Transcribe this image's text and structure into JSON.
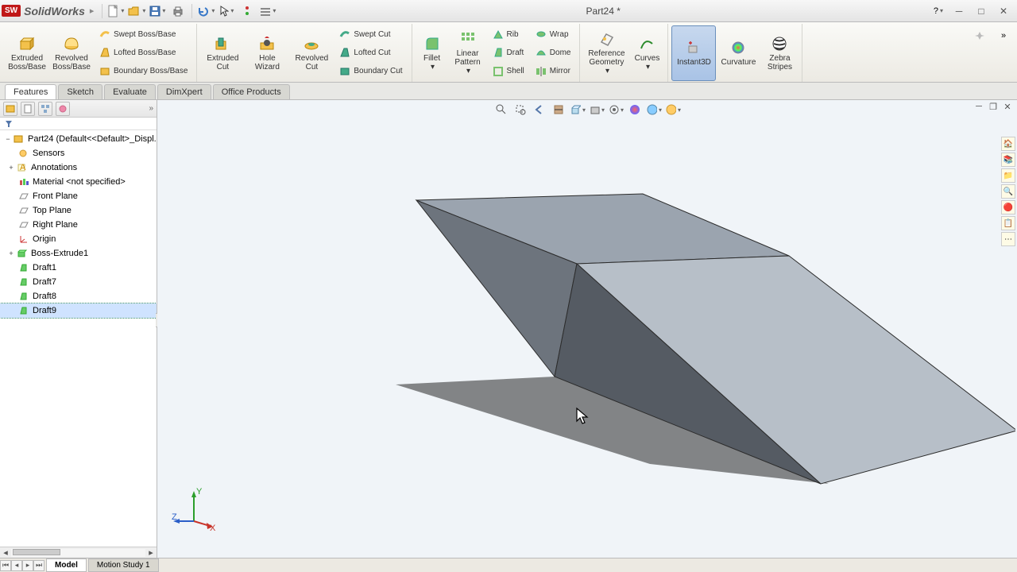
{
  "app": {
    "logo": "SW",
    "name": "SolidWorks",
    "title": "Part24 *"
  },
  "quickaccess": [
    "new",
    "open",
    "save",
    "print",
    "undo",
    "select",
    "rebuild",
    "options"
  ],
  "ribbon": {
    "extruded_boss": "Extruded Boss/Base",
    "revolved_boss": "Revolved Boss/Base",
    "swept_boss": "Swept Boss/Base",
    "lofted_boss": "Lofted Boss/Base",
    "boundary_boss": "Boundary Boss/Base",
    "extruded_cut": "Extruded Cut",
    "hole_wizard": "Hole Wizard",
    "revolved_cut": "Revolved Cut",
    "swept_cut": "Swept Cut",
    "lofted_cut": "Lofted Cut",
    "boundary_cut": "Boundary Cut",
    "fillet": "Fillet",
    "linear_pattern": "Linear Pattern",
    "rib": "Rib",
    "draft": "Draft",
    "shell": "Shell",
    "wrap": "Wrap",
    "dome": "Dome",
    "mirror": "Mirror",
    "ref_geometry": "Reference Geometry",
    "curves": "Curves",
    "instant3d": "Instant3D",
    "curvature": "Curvature",
    "zebra": "Zebra Stripes"
  },
  "tabs": [
    "Features",
    "Sketch",
    "Evaluate",
    "DimXpert",
    "Office Products"
  ],
  "tree": {
    "root": "Part24  (Default<<Default>_Displ.",
    "items": [
      {
        "label": "Sensors",
        "icon": "sensor"
      },
      {
        "label": "Annotations",
        "icon": "annot",
        "expand": "+"
      },
      {
        "label": "Material <not specified>",
        "icon": "material"
      },
      {
        "label": "Front Plane",
        "icon": "plane"
      },
      {
        "label": "Top Plane",
        "icon": "plane"
      },
      {
        "label": "Right Plane",
        "icon": "plane"
      },
      {
        "label": "Origin",
        "icon": "origin"
      },
      {
        "label": "Boss-Extrude1",
        "icon": "feature",
        "expand": "+"
      },
      {
        "label": "Draft1",
        "icon": "draft"
      },
      {
        "label": "Draft7",
        "icon": "draft"
      },
      {
        "label": "Draft8",
        "icon": "draft"
      },
      {
        "label": "Draft9",
        "icon": "draft",
        "sel": true
      }
    ]
  },
  "triad": {
    "x": "X",
    "y": "Y",
    "z": "Z"
  },
  "bottom": {
    "model": "Model",
    "motion": "Motion Study 1"
  }
}
